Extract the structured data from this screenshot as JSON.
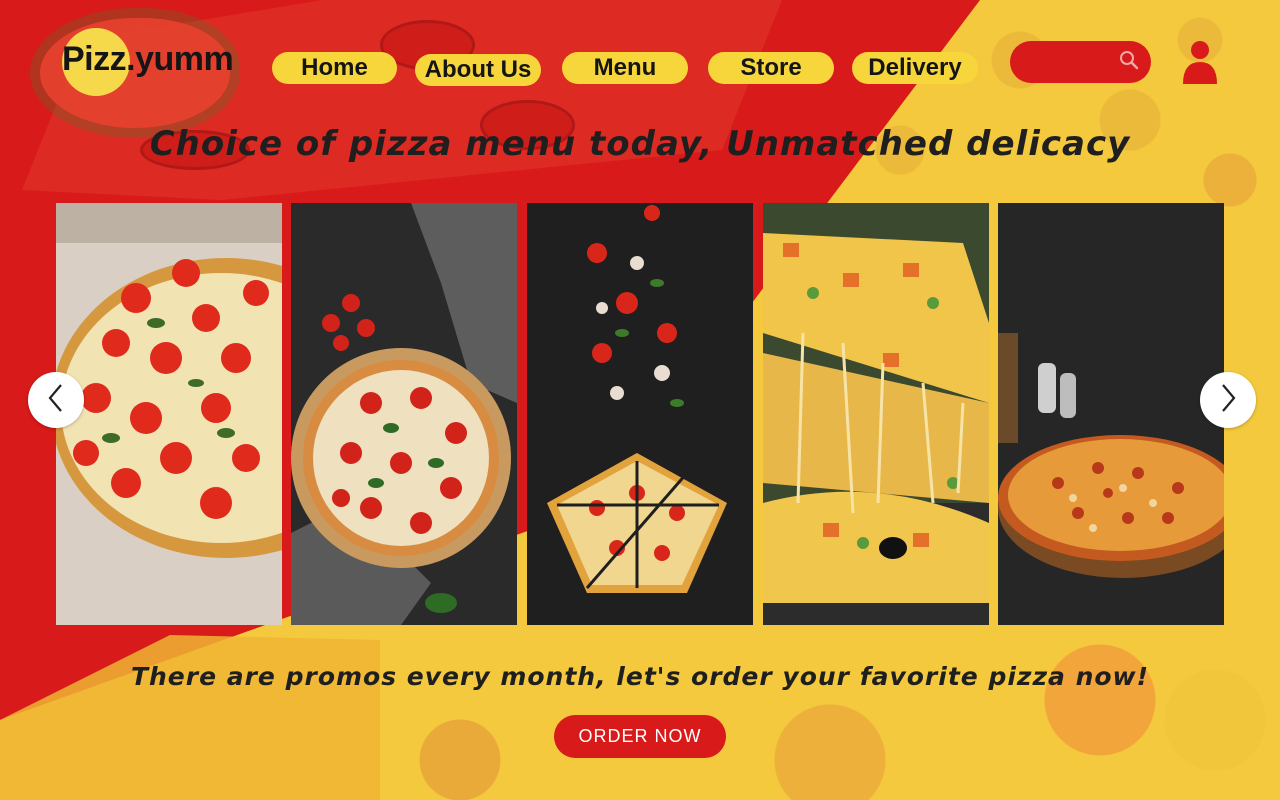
{
  "brand": {
    "name": "Pizz.yumm"
  },
  "nav": {
    "items": [
      {
        "label": "Home"
      },
      {
        "label": "About Us"
      },
      {
        "label": "Menu"
      },
      {
        "label": "Store"
      },
      {
        "label": "Delivery"
      }
    ]
  },
  "search": {
    "placeholder": "",
    "icon": "search-icon"
  },
  "account": {
    "icon": "user-icon"
  },
  "hero": {
    "headline": "Choice of pizza menu today, Unmatched delicacy"
  },
  "carousel": {
    "prev_icon": "chevron-left-icon",
    "next_icon": "chevron-right-icon",
    "slides": [
      {
        "subject": "tomato cauliflower-crust pizza on tray"
      },
      {
        "subject": "margherita pizza on wooden board"
      },
      {
        "subject": "falling toppings over sliced pizza"
      },
      {
        "subject": "cheese pull pizza slice"
      },
      {
        "subject": "pepperoni pizza on dark table"
      }
    ]
  },
  "promo": {
    "text": "There are promos every month, let's order your favorite pizza now!"
  },
  "cta": {
    "label": "ORDER NOW"
  },
  "colors": {
    "primary_red": "#d81a1a",
    "accent_yellow": "#f6d63a",
    "background_yellow": "#f4c93d",
    "text_dark": "#1f1f1f"
  }
}
